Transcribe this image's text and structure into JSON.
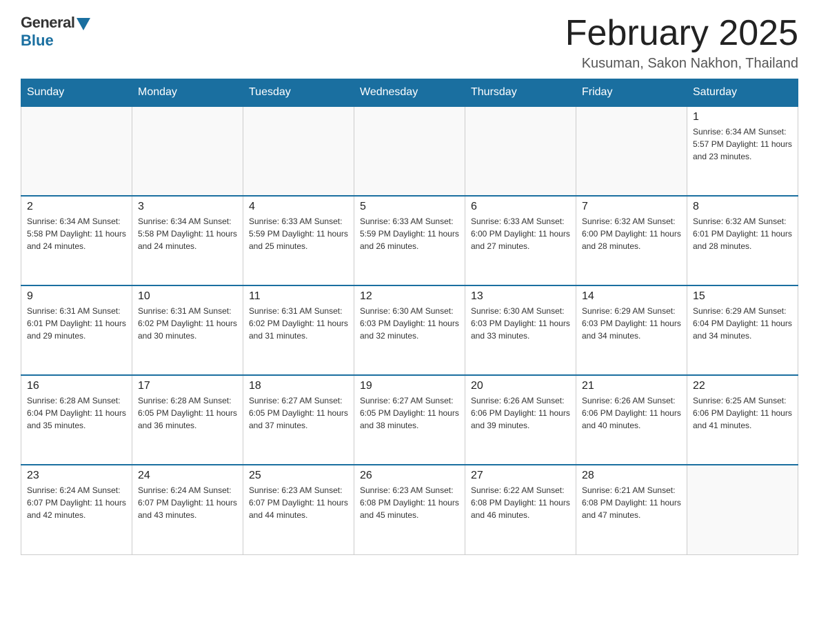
{
  "header": {
    "logo_general": "General",
    "logo_blue": "Blue",
    "month_title": "February 2025",
    "location": "Kusuman, Sakon Nakhon, Thailand"
  },
  "weekdays": [
    "Sunday",
    "Monday",
    "Tuesday",
    "Wednesday",
    "Thursday",
    "Friday",
    "Saturday"
  ],
  "weeks": [
    [
      {
        "day": "",
        "info": ""
      },
      {
        "day": "",
        "info": ""
      },
      {
        "day": "",
        "info": ""
      },
      {
        "day": "",
        "info": ""
      },
      {
        "day": "",
        "info": ""
      },
      {
        "day": "",
        "info": ""
      },
      {
        "day": "1",
        "info": "Sunrise: 6:34 AM\nSunset: 5:57 PM\nDaylight: 11 hours and 23 minutes."
      }
    ],
    [
      {
        "day": "2",
        "info": "Sunrise: 6:34 AM\nSunset: 5:58 PM\nDaylight: 11 hours and 24 minutes."
      },
      {
        "day": "3",
        "info": "Sunrise: 6:34 AM\nSunset: 5:58 PM\nDaylight: 11 hours and 24 minutes."
      },
      {
        "day": "4",
        "info": "Sunrise: 6:33 AM\nSunset: 5:59 PM\nDaylight: 11 hours and 25 minutes."
      },
      {
        "day": "5",
        "info": "Sunrise: 6:33 AM\nSunset: 5:59 PM\nDaylight: 11 hours and 26 minutes."
      },
      {
        "day": "6",
        "info": "Sunrise: 6:33 AM\nSunset: 6:00 PM\nDaylight: 11 hours and 27 minutes."
      },
      {
        "day": "7",
        "info": "Sunrise: 6:32 AM\nSunset: 6:00 PM\nDaylight: 11 hours and 28 minutes."
      },
      {
        "day": "8",
        "info": "Sunrise: 6:32 AM\nSunset: 6:01 PM\nDaylight: 11 hours and 28 minutes."
      }
    ],
    [
      {
        "day": "9",
        "info": "Sunrise: 6:31 AM\nSunset: 6:01 PM\nDaylight: 11 hours and 29 minutes."
      },
      {
        "day": "10",
        "info": "Sunrise: 6:31 AM\nSunset: 6:02 PM\nDaylight: 11 hours and 30 minutes."
      },
      {
        "day": "11",
        "info": "Sunrise: 6:31 AM\nSunset: 6:02 PM\nDaylight: 11 hours and 31 minutes."
      },
      {
        "day": "12",
        "info": "Sunrise: 6:30 AM\nSunset: 6:03 PM\nDaylight: 11 hours and 32 minutes."
      },
      {
        "day": "13",
        "info": "Sunrise: 6:30 AM\nSunset: 6:03 PM\nDaylight: 11 hours and 33 minutes."
      },
      {
        "day": "14",
        "info": "Sunrise: 6:29 AM\nSunset: 6:03 PM\nDaylight: 11 hours and 34 minutes."
      },
      {
        "day": "15",
        "info": "Sunrise: 6:29 AM\nSunset: 6:04 PM\nDaylight: 11 hours and 34 minutes."
      }
    ],
    [
      {
        "day": "16",
        "info": "Sunrise: 6:28 AM\nSunset: 6:04 PM\nDaylight: 11 hours and 35 minutes."
      },
      {
        "day": "17",
        "info": "Sunrise: 6:28 AM\nSunset: 6:05 PM\nDaylight: 11 hours and 36 minutes."
      },
      {
        "day": "18",
        "info": "Sunrise: 6:27 AM\nSunset: 6:05 PM\nDaylight: 11 hours and 37 minutes."
      },
      {
        "day": "19",
        "info": "Sunrise: 6:27 AM\nSunset: 6:05 PM\nDaylight: 11 hours and 38 minutes."
      },
      {
        "day": "20",
        "info": "Sunrise: 6:26 AM\nSunset: 6:06 PM\nDaylight: 11 hours and 39 minutes."
      },
      {
        "day": "21",
        "info": "Sunrise: 6:26 AM\nSunset: 6:06 PM\nDaylight: 11 hours and 40 minutes."
      },
      {
        "day": "22",
        "info": "Sunrise: 6:25 AM\nSunset: 6:06 PM\nDaylight: 11 hours and 41 minutes."
      }
    ],
    [
      {
        "day": "23",
        "info": "Sunrise: 6:24 AM\nSunset: 6:07 PM\nDaylight: 11 hours and 42 minutes."
      },
      {
        "day": "24",
        "info": "Sunrise: 6:24 AM\nSunset: 6:07 PM\nDaylight: 11 hours and 43 minutes."
      },
      {
        "day": "25",
        "info": "Sunrise: 6:23 AM\nSunset: 6:07 PM\nDaylight: 11 hours and 44 minutes."
      },
      {
        "day": "26",
        "info": "Sunrise: 6:23 AM\nSunset: 6:08 PM\nDaylight: 11 hours and 45 minutes."
      },
      {
        "day": "27",
        "info": "Sunrise: 6:22 AM\nSunset: 6:08 PM\nDaylight: 11 hours and 46 minutes."
      },
      {
        "day": "28",
        "info": "Sunrise: 6:21 AM\nSunset: 6:08 PM\nDaylight: 11 hours and 47 minutes."
      },
      {
        "day": "",
        "info": ""
      }
    ]
  ]
}
